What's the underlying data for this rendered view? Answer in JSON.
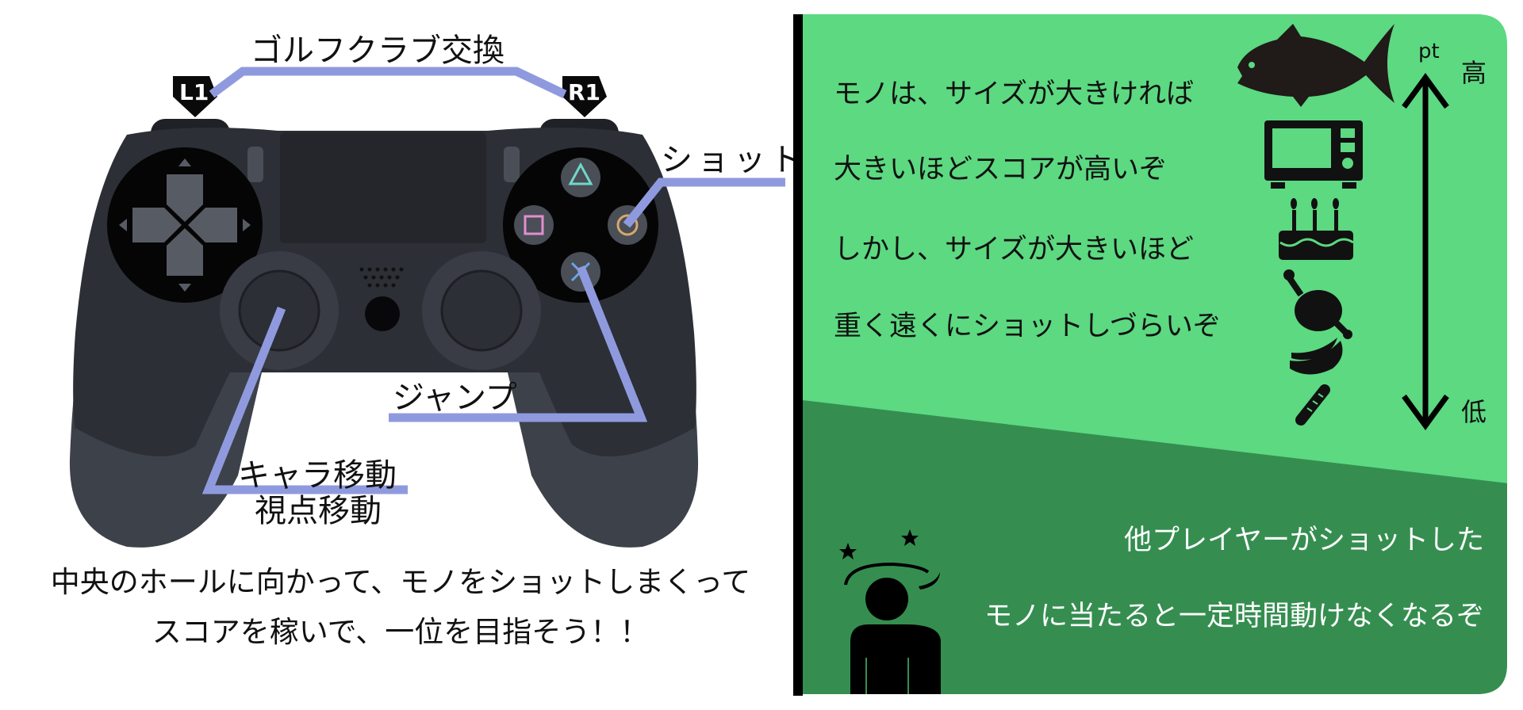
{
  "controller": {
    "labels": {
      "club_swap": "ゴルフクラブ交換",
      "l1": "L1",
      "r1": "R1",
      "shot": "ショット",
      "jump": "ジャンプ",
      "move": "キャラ移動",
      "camera": "視点移動"
    },
    "message": [
      "中央のホールに向かって、モノをショットしまくって",
      "スコアを稼いで、一位を目指そう！！"
    ]
  },
  "panel": {
    "lines": [
      "モノは、サイズが大きければ",
      "大きいほどスコアが高いぞ",
      "しかし、サイズが大きいほど",
      "重く遠くにショットしづらいぞ"
    ],
    "scale": {
      "unit": "pt",
      "high": "高",
      "low": "低"
    },
    "items": [
      "fish",
      "microwave",
      "cake",
      "chicken",
      "banana",
      "bread"
    ],
    "warning": [
      "他プレイヤーがショットした",
      "モノに当たると一定時間動けなくなるぞ"
    ]
  },
  "colors": {
    "light_green": "#5cd981",
    "dark_green": "#358e50",
    "guide_line": "#8f9ade",
    "controller_body": "#2c2f36"
  }
}
